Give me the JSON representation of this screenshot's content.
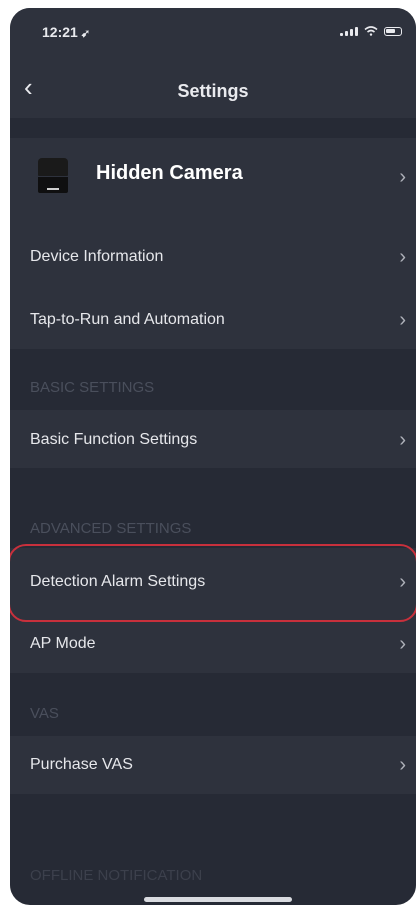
{
  "status_bar": {
    "time": "12:21",
    "location_glyph": "➹"
  },
  "nav": {
    "back_glyph": "‹",
    "title": "Settings"
  },
  "device": {
    "name": "Hidden Camera"
  },
  "rows": [
    {
      "label": "Device Information"
    },
    {
      "label": "Tap-to-Run and Automation"
    }
  ],
  "sections": {
    "basic": {
      "title": "BASIC SETTINGS",
      "items": [
        {
          "label": "Basic Function Settings"
        }
      ]
    },
    "advanced": {
      "title": "ADVANCED SETTINGS",
      "items": [
        {
          "label": "Detection Alarm Settings"
        },
        {
          "label": "AP Mode"
        }
      ]
    },
    "vas": {
      "title": "VAS",
      "items": [
        {
          "label": "Purchase VAS"
        }
      ]
    },
    "offline": {
      "title": "OFFLINE NOTIFICATION"
    }
  },
  "chevron_glyph": "›",
  "colors": {
    "background": "#262a35",
    "row": "#2e323d",
    "highlight": "#c8303c",
    "section_text": "#4a4f5c"
  }
}
